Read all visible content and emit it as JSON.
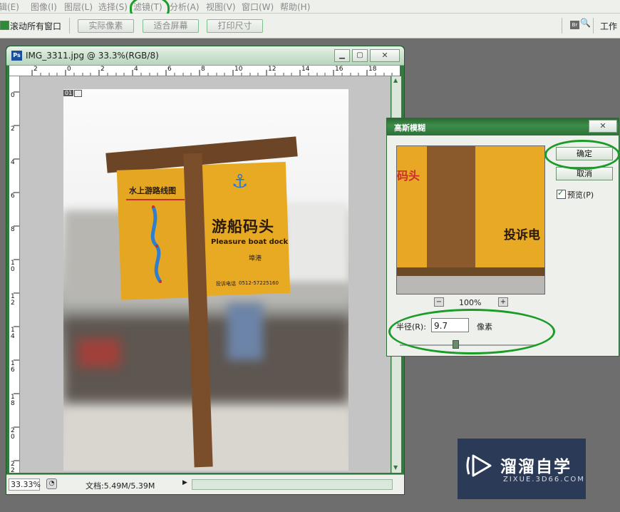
{
  "menu": [
    "辑(E)",
    "图像(I)",
    "图层(L)",
    "选择(S)",
    "滤镜(T)",
    "分析(A)",
    "视图(V)",
    "窗口(W)",
    "帮助(H)"
  ],
  "options": {
    "scroll_all_label": "滚动所有窗口",
    "actual_pixels": "实际像素",
    "fit_screen": "适合屏幕",
    "print_size": "打印尺寸",
    "bridge_icon": "Br",
    "workspace": "工作"
  },
  "document": {
    "title": "IMG_3311.jpg @ 33.3%(RGB/8)",
    "ruler_h": [
      "2",
      "0",
      "2",
      "4",
      "6",
      "8",
      "10",
      "12",
      "14",
      "16",
      "18"
    ],
    "ruler_v": [
      "0",
      "2",
      "4",
      "6",
      "8",
      "10",
      "12",
      "14",
      "16",
      "18",
      "20",
      "22"
    ],
    "zoom": "33.33%",
    "doc_info": "文档:5.49M/5.39M",
    "layer_tag": "01"
  },
  "sign": {
    "left_title": "水上游路线图",
    "right_title": "游船码头",
    "english": "Pleasure boat dock",
    "sub": "埠港",
    "bottom_left": "投诉电话",
    "phone": "0512-57225160"
  },
  "dialog": {
    "title": "高斯模糊",
    "ok": "确定",
    "cancel": "取消",
    "preview_label": "预览(P)",
    "zoom_level": "100%",
    "radius_label": "半径(R):",
    "radius_value": "9.7",
    "unit": "像素",
    "preview_text_1": "码头",
    "preview_text_2": "投诉电"
  },
  "logo": {
    "name": "溜溜自学",
    "url": "ZIXUE.3D66.COM"
  },
  "colors": {
    "window_green": "#2f7a3c",
    "annotation_green": "#1b9b27",
    "sign_yellow": "#e5a722",
    "post_brown": "#7a4e2a"
  }
}
